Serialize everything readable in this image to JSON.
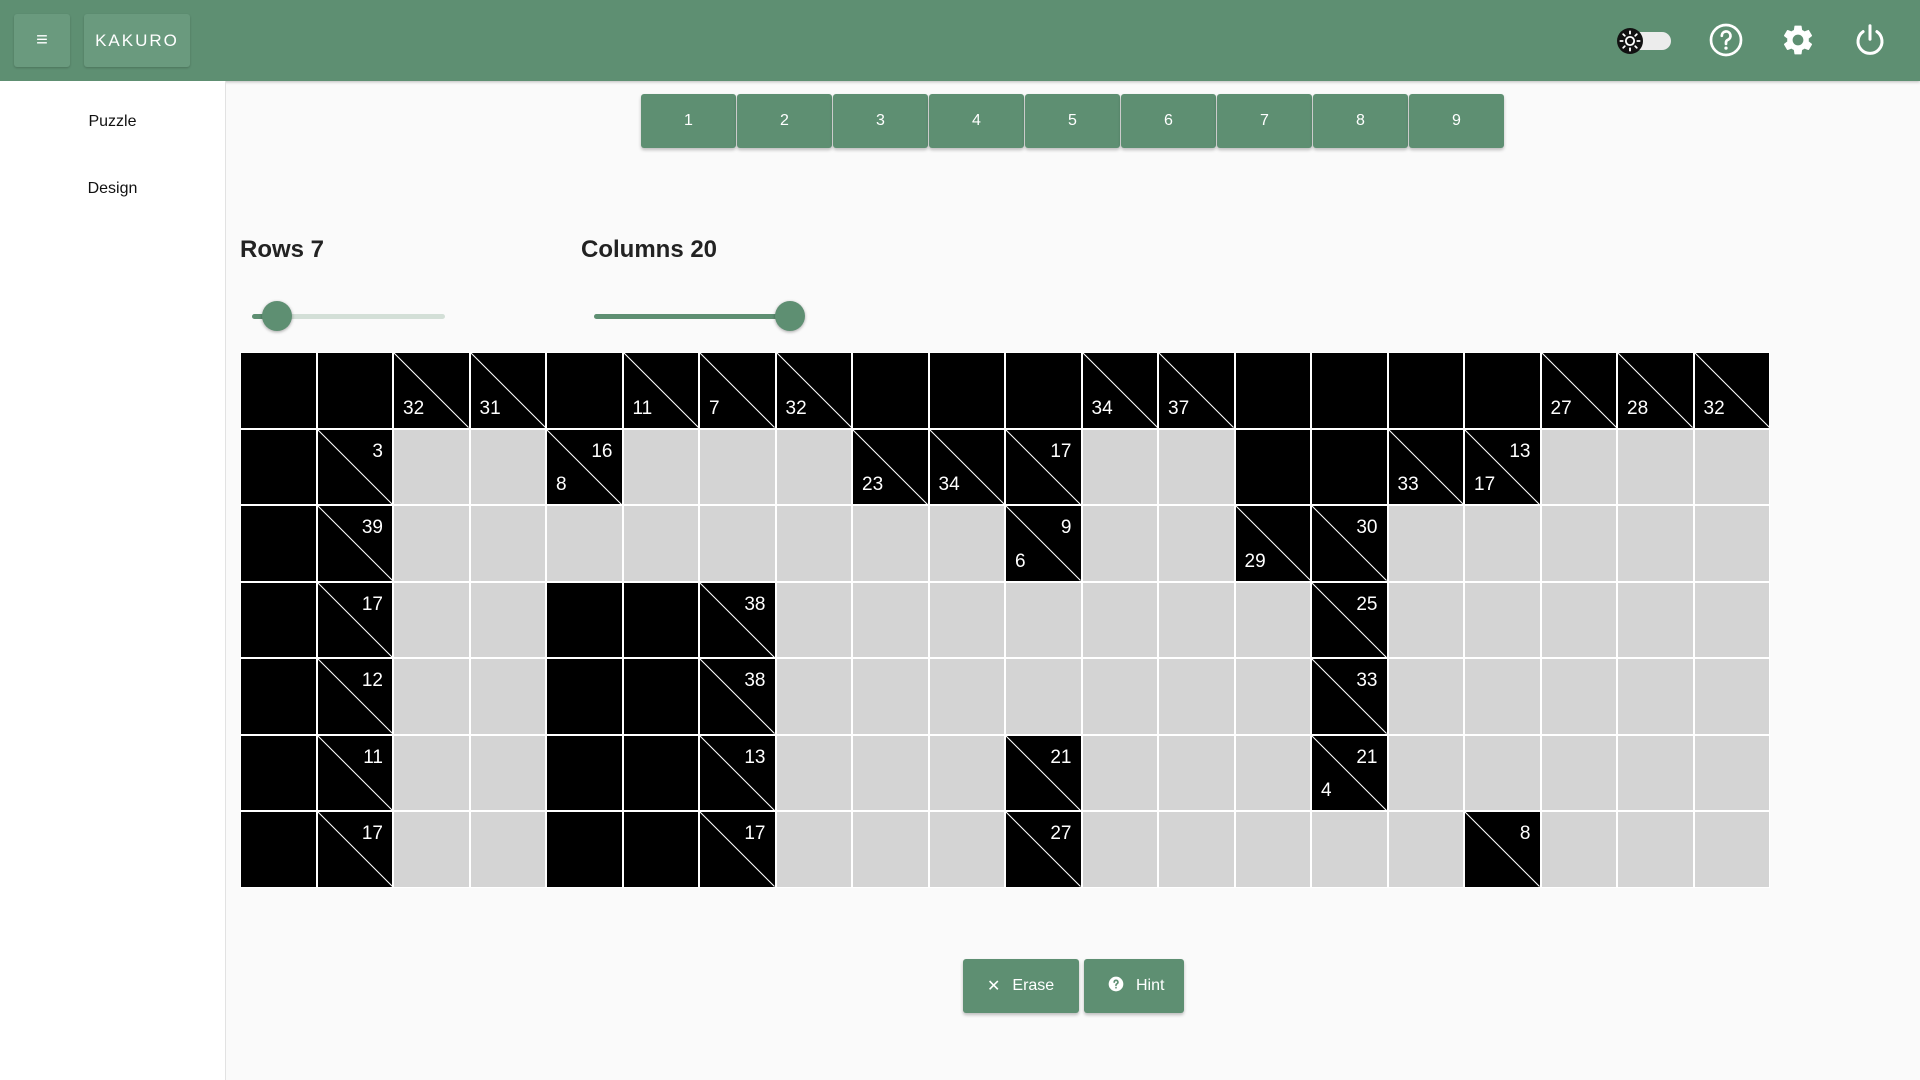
{
  "header": {
    "menu_icon": "hamburger-menu-icon",
    "app_title": "KAKURO",
    "icons": [
      "theme-toggle",
      "help-icon",
      "settings-gear-icon",
      "power-icon"
    ],
    "accent_color": "#5e8f72"
  },
  "sidebar": {
    "items": [
      {
        "label": "Puzzle"
      },
      {
        "label": "Design"
      }
    ]
  },
  "numpad": [
    "1",
    "2",
    "3",
    "4",
    "5",
    "6",
    "7",
    "8",
    "9"
  ],
  "rows_slider": {
    "label": "Rows 7",
    "value": 7,
    "fill_fraction": 0.13
  },
  "columns_slider": {
    "label": "Columns 20",
    "value": 20,
    "fill_fraction": 1.0
  },
  "board": {
    "rows": 7,
    "cols": 20,
    "cells": [
      [
        {
          "t": "b"
        },
        {
          "t": "b"
        },
        {
          "t": "c",
          "d": "32"
        },
        {
          "t": "c",
          "d": "31"
        },
        {
          "t": "b"
        },
        {
          "t": "c",
          "d": "11"
        },
        {
          "t": "c",
          "d": "7"
        },
        {
          "t": "c",
          "d": "32"
        },
        {
          "t": "b"
        },
        {
          "t": "b"
        },
        {
          "t": "b"
        },
        {
          "t": "c",
          "d": "34"
        },
        {
          "t": "c",
          "d": "37"
        },
        {
          "t": "b"
        },
        {
          "t": "b"
        },
        {
          "t": "b"
        },
        {
          "t": "b"
        },
        {
          "t": "c",
          "d": "27"
        },
        {
          "t": "c",
          "d": "28"
        },
        {
          "t": "c",
          "d": "32"
        }
      ],
      [
        {
          "t": "b"
        },
        {
          "t": "c",
          "r": "3"
        },
        {
          "t": "w"
        },
        {
          "t": "w"
        },
        {
          "t": "c",
          "r": "16",
          "d": "8"
        },
        {
          "t": "w"
        },
        {
          "t": "w"
        },
        {
          "t": "w"
        },
        {
          "t": "c",
          "d": "23"
        },
        {
          "t": "c",
          "d": "34"
        },
        {
          "t": "c",
          "r": "17"
        },
        {
          "t": "w"
        },
        {
          "t": "w"
        },
        {
          "t": "b"
        },
        {
          "t": "b"
        },
        {
          "t": "c",
          "d": "33"
        },
        {
          "t": "c",
          "r": "13",
          "d": "17"
        },
        {
          "t": "w"
        },
        {
          "t": "w"
        },
        {
          "t": "w"
        }
      ],
      [
        {
          "t": "b"
        },
        {
          "t": "c",
          "r": "39"
        },
        {
          "t": "w"
        },
        {
          "t": "w"
        },
        {
          "t": "w"
        },
        {
          "t": "w"
        },
        {
          "t": "w"
        },
        {
          "t": "w"
        },
        {
          "t": "w"
        },
        {
          "t": "w"
        },
        {
          "t": "c",
          "r": "9",
          "d": "6"
        },
        {
          "t": "w"
        },
        {
          "t": "w"
        },
        {
          "t": "c",
          "d": "29"
        },
        {
          "t": "c",
          "r": "30"
        },
        {
          "t": "w"
        },
        {
          "t": "w"
        },
        {
          "t": "w"
        },
        {
          "t": "w"
        },
        {
          "t": "w"
        }
      ],
      [
        {
          "t": "b"
        },
        {
          "t": "c",
          "r": "17"
        },
        {
          "t": "w"
        },
        {
          "t": "w"
        },
        {
          "t": "b"
        },
        {
          "t": "b"
        },
        {
          "t": "c",
          "r": "38"
        },
        {
          "t": "w"
        },
        {
          "t": "w"
        },
        {
          "t": "w"
        },
        {
          "t": "w"
        },
        {
          "t": "w"
        },
        {
          "t": "w"
        },
        {
          "t": "w"
        },
        {
          "t": "c",
          "r": "25"
        },
        {
          "t": "w"
        },
        {
          "t": "w"
        },
        {
          "t": "w"
        },
        {
          "t": "w"
        },
        {
          "t": "w"
        }
      ],
      [
        {
          "t": "b"
        },
        {
          "t": "c",
          "r": "12"
        },
        {
          "t": "w"
        },
        {
          "t": "w"
        },
        {
          "t": "b"
        },
        {
          "t": "b"
        },
        {
          "t": "c",
          "r": "38"
        },
        {
          "t": "w"
        },
        {
          "t": "w"
        },
        {
          "t": "w"
        },
        {
          "t": "w"
        },
        {
          "t": "w"
        },
        {
          "t": "w"
        },
        {
          "t": "w"
        },
        {
          "t": "c",
          "r": "33"
        },
        {
          "t": "w"
        },
        {
          "t": "w"
        },
        {
          "t": "w"
        },
        {
          "t": "w"
        },
        {
          "t": "w"
        }
      ],
      [
        {
          "t": "b"
        },
        {
          "t": "c",
          "r": "11"
        },
        {
          "t": "w"
        },
        {
          "t": "w"
        },
        {
          "t": "b"
        },
        {
          "t": "b"
        },
        {
          "t": "c",
          "r": "13"
        },
        {
          "t": "w"
        },
        {
          "t": "w"
        },
        {
          "t": "w"
        },
        {
          "t": "c",
          "r": "21"
        },
        {
          "t": "w"
        },
        {
          "t": "w"
        },
        {
          "t": "w"
        },
        {
          "t": "c",
          "r": "21",
          "d": "4"
        },
        {
          "t": "w"
        },
        {
          "t": "w"
        },
        {
          "t": "w"
        },
        {
          "t": "w"
        },
        {
          "t": "w"
        }
      ],
      [
        {
          "t": "b"
        },
        {
          "t": "c",
          "r": "17"
        },
        {
          "t": "w"
        },
        {
          "t": "w"
        },
        {
          "t": "b"
        },
        {
          "t": "b"
        },
        {
          "t": "c",
          "r": "17"
        },
        {
          "t": "w"
        },
        {
          "t": "w"
        },
        {
          "t": "w"
        },
        {
          "t": "c",
          "r": "27"
        },
        {
          "t": "w"
        },
        {
          "t": "w"
        },
        {
          "t": "w"
        },
        {
          "t": "w"
        },
        {
          "t": "w"
        },
        {
          "t": "c",
          "r": "8"
        },
        {
          "t": "w"
        },
        {
          "t": "w"
        },
        {
          "t": "w"
        }
      ]
    ]
  },
  "actions": {
    "erase_label": "Erase",
    "erase_icon": "close-x-icon",
    "hint_label": "Hint",
    "hint_icon": "question-circle-icon"
  }
}
